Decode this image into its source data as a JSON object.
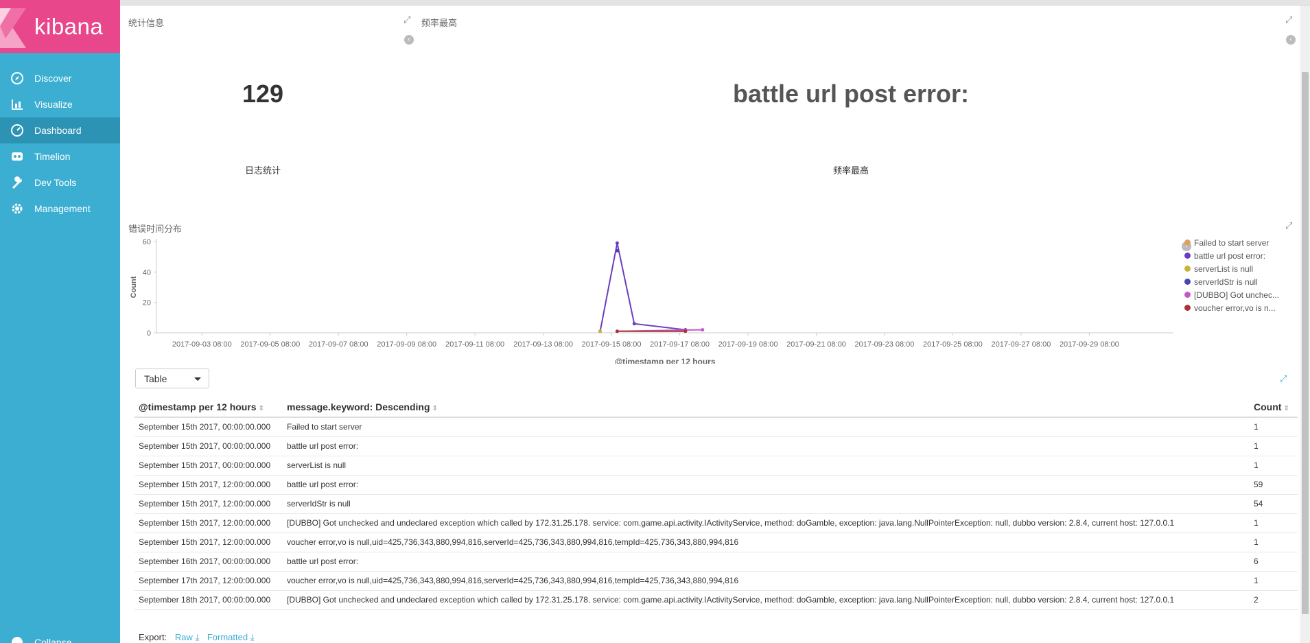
{
  "sidebar": {
    "logo": "kibana",
    "items": [
      {
        "label": "Discover",
        "icon": "compass-icon"
      },
      {
        "label": "Visualize",
        "icon": "bar-chart-icon"
      },
      {
        "label": "Dashboard",
        "icon": "dashboard-icon",
        "active": true
      },
      {
        "label": "Timelion",
        "icon": "timelion-icon"
      },
      {
        "label": "Dev Tools",
        "icon": "wrench-icon"
      },
      {
        "label": "Management",
        "icon": "gear-icon"
      }
    ],
    "collapse_label": "Collapse"
  },
  "panels": {
    "stats": {
      "title": "统计信息",
      "value": "129",
      "label": "日志统计"
    },
    "top": {
      "title": "频率最高",
      "value": "battle url post error:",
      "label": "频率最高"
    },
    "chart": {
      "title": "错误时间分布"
    }
  },
  "chart_data": {
    "type": "line",
    "ylabel": "Count",
    "xlabel": "@timestamp per 12 hours",
    "ylim": [
      0,
      60
    ],
    "yticks": [
      0,
      20,
      40,
      60
    ],
    "x_tick_labels": [
      "2017-09-03 08:00",
      "2017-09-05 08:00",
      "2017-09-07 08:00",
      "2017-09-09 08:00",
      "2017-09-11 08:00",
      "2017-09-13 08:00",
      "2017-09-15 08:00",
      "2017-09-17 08:00",
      "2017-09-19 08:00",
      "2017-09-21 08:00",
      "2017-09-23 08:00",
      "2017-09-25 08:00",
      "2017-09-27 08:00",
      "2017-09-29 08:00"
    ],
    "series": [
      {
        "name": "Failed to start server",
        "color": "#e0a158",
        "points": [
          [
            "2017-09-15 00:00",
            1
          ]
        ]
      },
      {
        "name": "battle url post error:",
        "color": "#6d3bc2",
        "points": [
          [
            "2017-09-15 00:00",
            1
          ],
          [
            "2017-09-15 12:00",
            59
          ],
          [
            "2017-09-16 00:00",
            6
          ],
          [
            "2017-09-17 12:00",
            2
          ]
        ]
      },
      {
        "name": "serverList is null",
        "color": "#c8b43d",
        "points": [
          [
            "2017-09-15 00:00",
            1
          ]
        ]
      },
      {
        "name": "serverIdStr is null",
        "color": "#4646b0",
        "points": [
          [
            "2017-09-15 12:00",
            54
          ]
        ]
      },
      {
        "name": "[DUBBO] Got unchec...",
        "color": "#c558c7",
        "points": [
          [
            "2017-09-15 12:00",
            1
          ],
          [
            "2017-09-18 00:00",
            2
          ]
        ]
      },
      {
        "name": "voucher error,vo is n...",
        "color": "#a83434",
        "points": [
          [
            "2017-09-15 12:00",
            1
          ],
          [
            "2017-09-17 12:00",
            1
          ]
        ]
      }
    ]
  },
  "table_panel": {
    "select_value": "Table",
    "headers": [
      "@timestamp per 12 hours",
      "message.keyword: Descending",
      "Count"
    ],
    "rows": [
      [
        "September 15th 2017, 00:00:00.000",
        "Failed to start server",
        "1"
      ],
      [
        "September 15th 2017, 00:00:00.000",
        "battle url post error:",
        "1"
      ],
      [
        "September 15th 2017, 00:00:00.000",
        "serverList is null",
        "1"
      ],
      [
        "September 15th 2017, 12:00:00.000",
        "battle url post error:",
        "59"
      ],
      [
        "September 15th 2017, 12:00:00.000",
        "serverIdStr is null",
        "54"
      ],
      [
        "September 15th 2017, 12:00:00.000",
        "[DUBBO] Got unchecked and undeclared exception which called by 172.31.25.178. service: com.game.api.activity.IActivityService, method: doGamble, exception: java.lang.NullPointerException: null, dubbo version: 2.8.4, current host: 127.0.0.1",
        "1"
      ],
      [
        "September 15th 2017, 12:00:00.000",
        "voucher error,vo is null,uid=425,736,343,880,994,816,serverId=425,736,343,880,994,816,tempId=425,736,343,880,994,816",
        "1"
      ],
      [
        "September 16th 2017, 00:00:00.000",
        "battle url post error:",
        "6"
      ],
      [
        "September 17th 2017, 12:00:00.000",
        "voucher error,vo is null,uid=425,736,343,880,994,816,serverId=425,736,343,880,994,816,tempId=425,736,343,880,994,816",
        "1"
      ],
      [
        "September 18th 2017, 00:00:00.000",
        "[DUBBO] Got unchecked and undeclared exception which called by 172.31.25.178. service: com.game.api.activity.IActivityService, method: doGamble, exception: java.lang.NullPointerException: null, dubbo version: 2.8.4, current host: 127.0.0.1",
        "2"
      ]
    ],
    "export_label": "Export:",
    "raw_label": "Raw",
    "formatted_label": "Formatted"
  }
}
